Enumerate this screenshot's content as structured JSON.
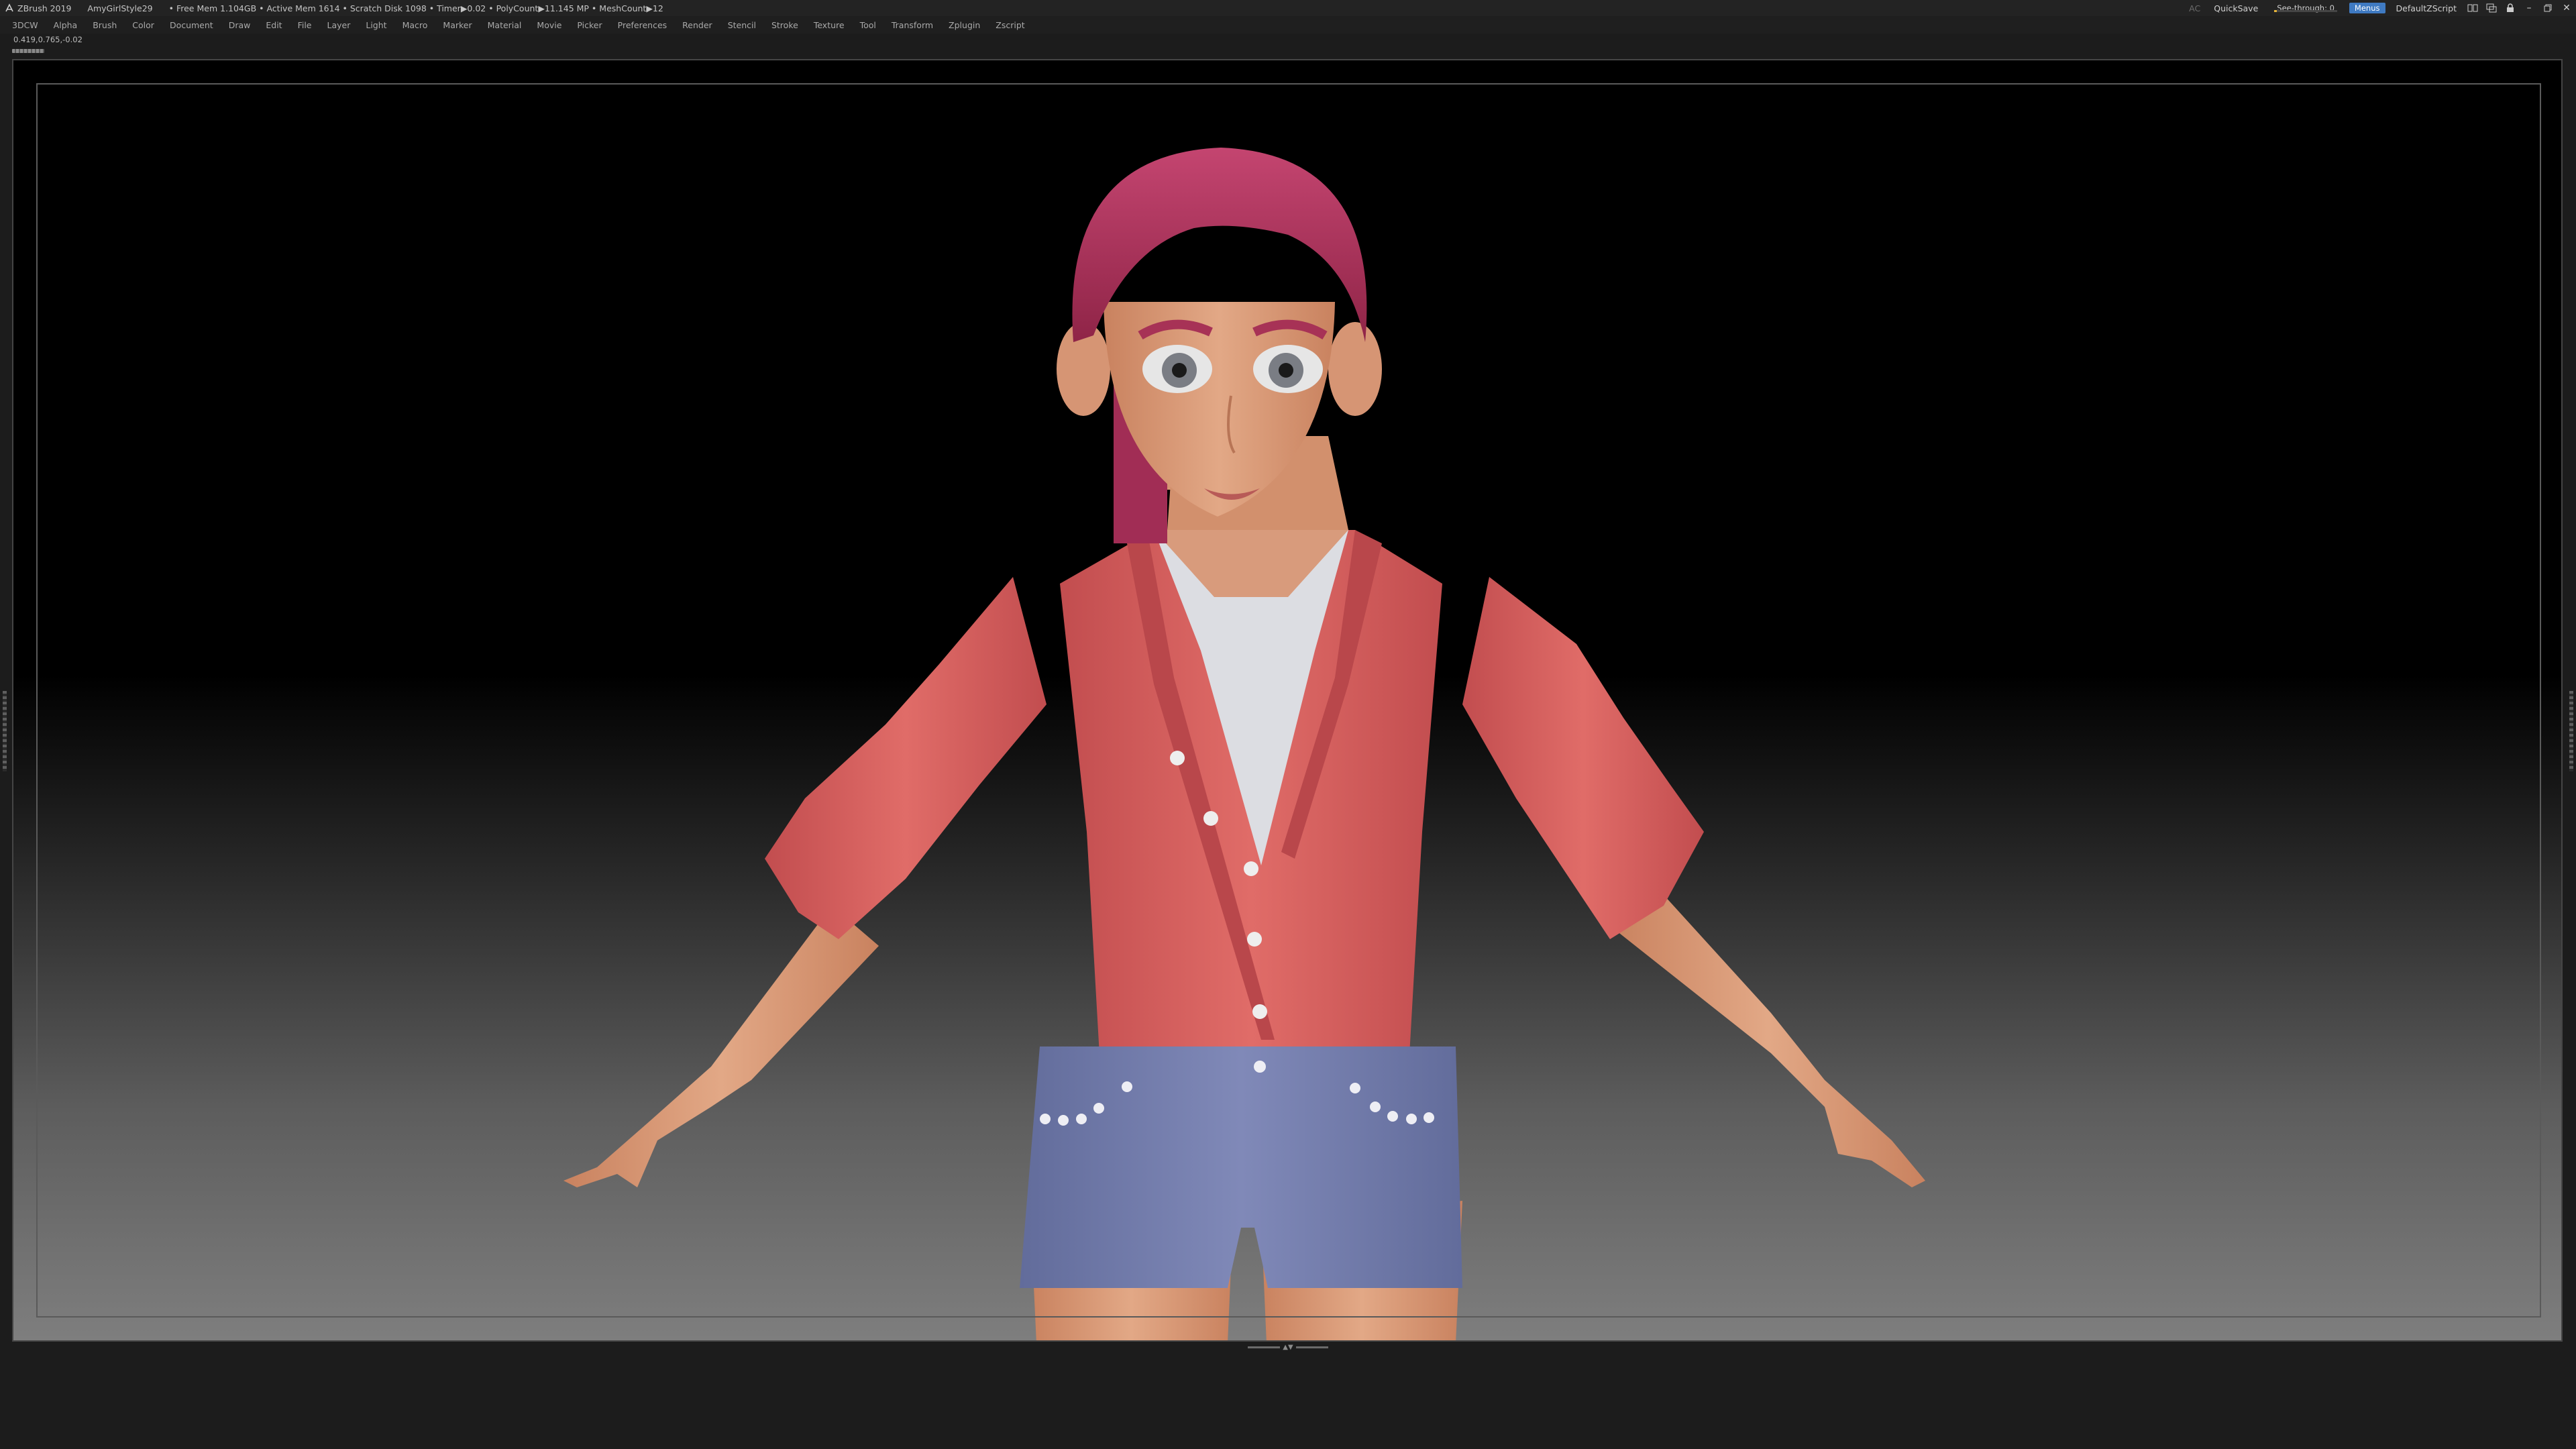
{
  "titlebar": {
    "app": "ZBrush 2019",
    "document": "AmyGirlStyle29",
    "stats": "• Free Mem 1.104GB • Active Mem 1614 • Scratch Disk 1098 • Timer▶0.02 • PolyCount▶11.145 MP • MeshCount▶12",
    "ac_label": "AC",
    "quicksave": "QuickSave",
    "see_through_label": "See-through",
    "see_through_value": "0",
    "see_through_fraction": 0.0,
    "menus_label": "Menus",
    "script_label": "DefaultZScript"
  },
  "menubar": {
    "items": [
      "3DCW",
      "Alpha",
      "Brush",
      "Color",
      "Document",
      "Draw",
      "Edit",
      "File",
      "Layer",
      "Light",
      "Macro",
      "Marker",
      "Material",
      "Movie",
      "Picker",
      "Preferences",
      "Render",
      "Stencil",
      "Stroke",
      "Texture",
      "Tool",
      "Transform",
      "Zplugin",
      "Zscript"
    ]
  },
  "status": {
    "coords": "0.419,0.765,-0.02"
  },
  "icons": {
    "app_logo": "zbrush-logo-icon",
    "window_controls": [
      "layout-icon",
      "palette-icon",
      "lock-icon",
      "minimize-icon",
      "maximize-icon",
      "close-icon"
    ]
  },
  "colors": {
    "accent": "#3f7ac2",
    "slider": "#e5b43a",
    "skin": "#d99a78",
    "hair": "#b8355f",
    "shirt": "#d95f5f",
    "tank": "#dcdde2",
    "shorts": "#7580ad"
  }
}
